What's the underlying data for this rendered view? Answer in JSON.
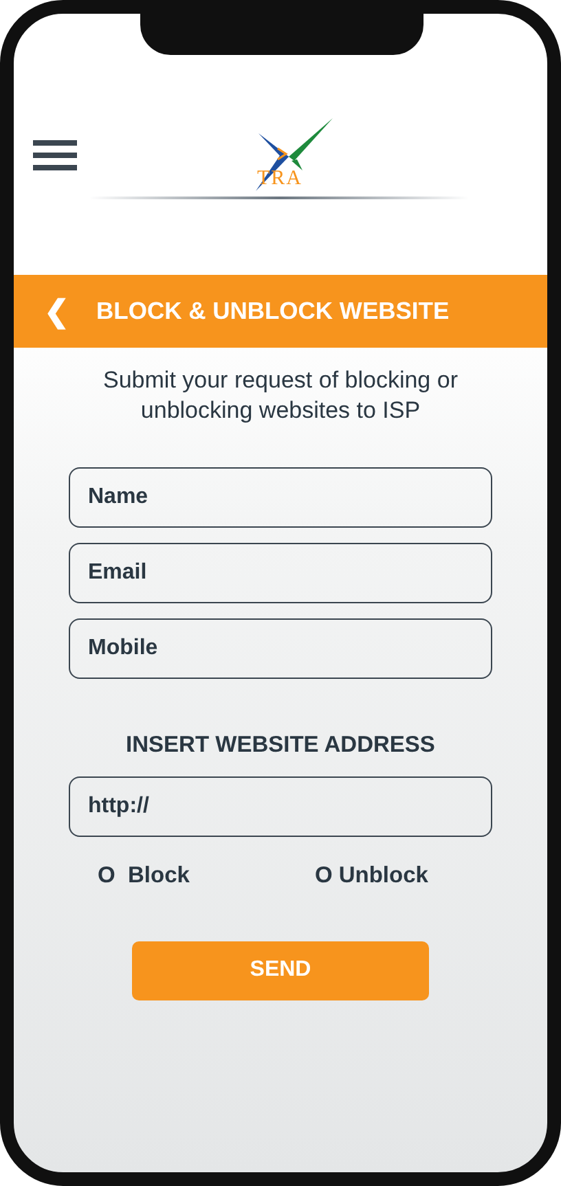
{
  "header": {
    "logo_text": "TRA"
  },
  "title_bar": {
    "back": "❮",
    "title": "BLOCK & UNBLOCK WEBSITE"
  },
  "intro": "Submit your request of blocking or unblocking websites to ISP",
  "fields": [
    {
      "placeholder": "Name"
    },
    {
      "placeholder": "Email"
    },
    {
      "placeholder": "Mobile"
    }
  ],
  "address": {
    "label": "INSERT WEBSITE ADDRESS",
    "placeholder": "http://"
  },
  "options": [
    {
      "marker": "O",
      "label": "Block"
    },
    {
      "marker": "O",
      "label": "Unblock"
    }
  ],
  "button": "SEND"
}
